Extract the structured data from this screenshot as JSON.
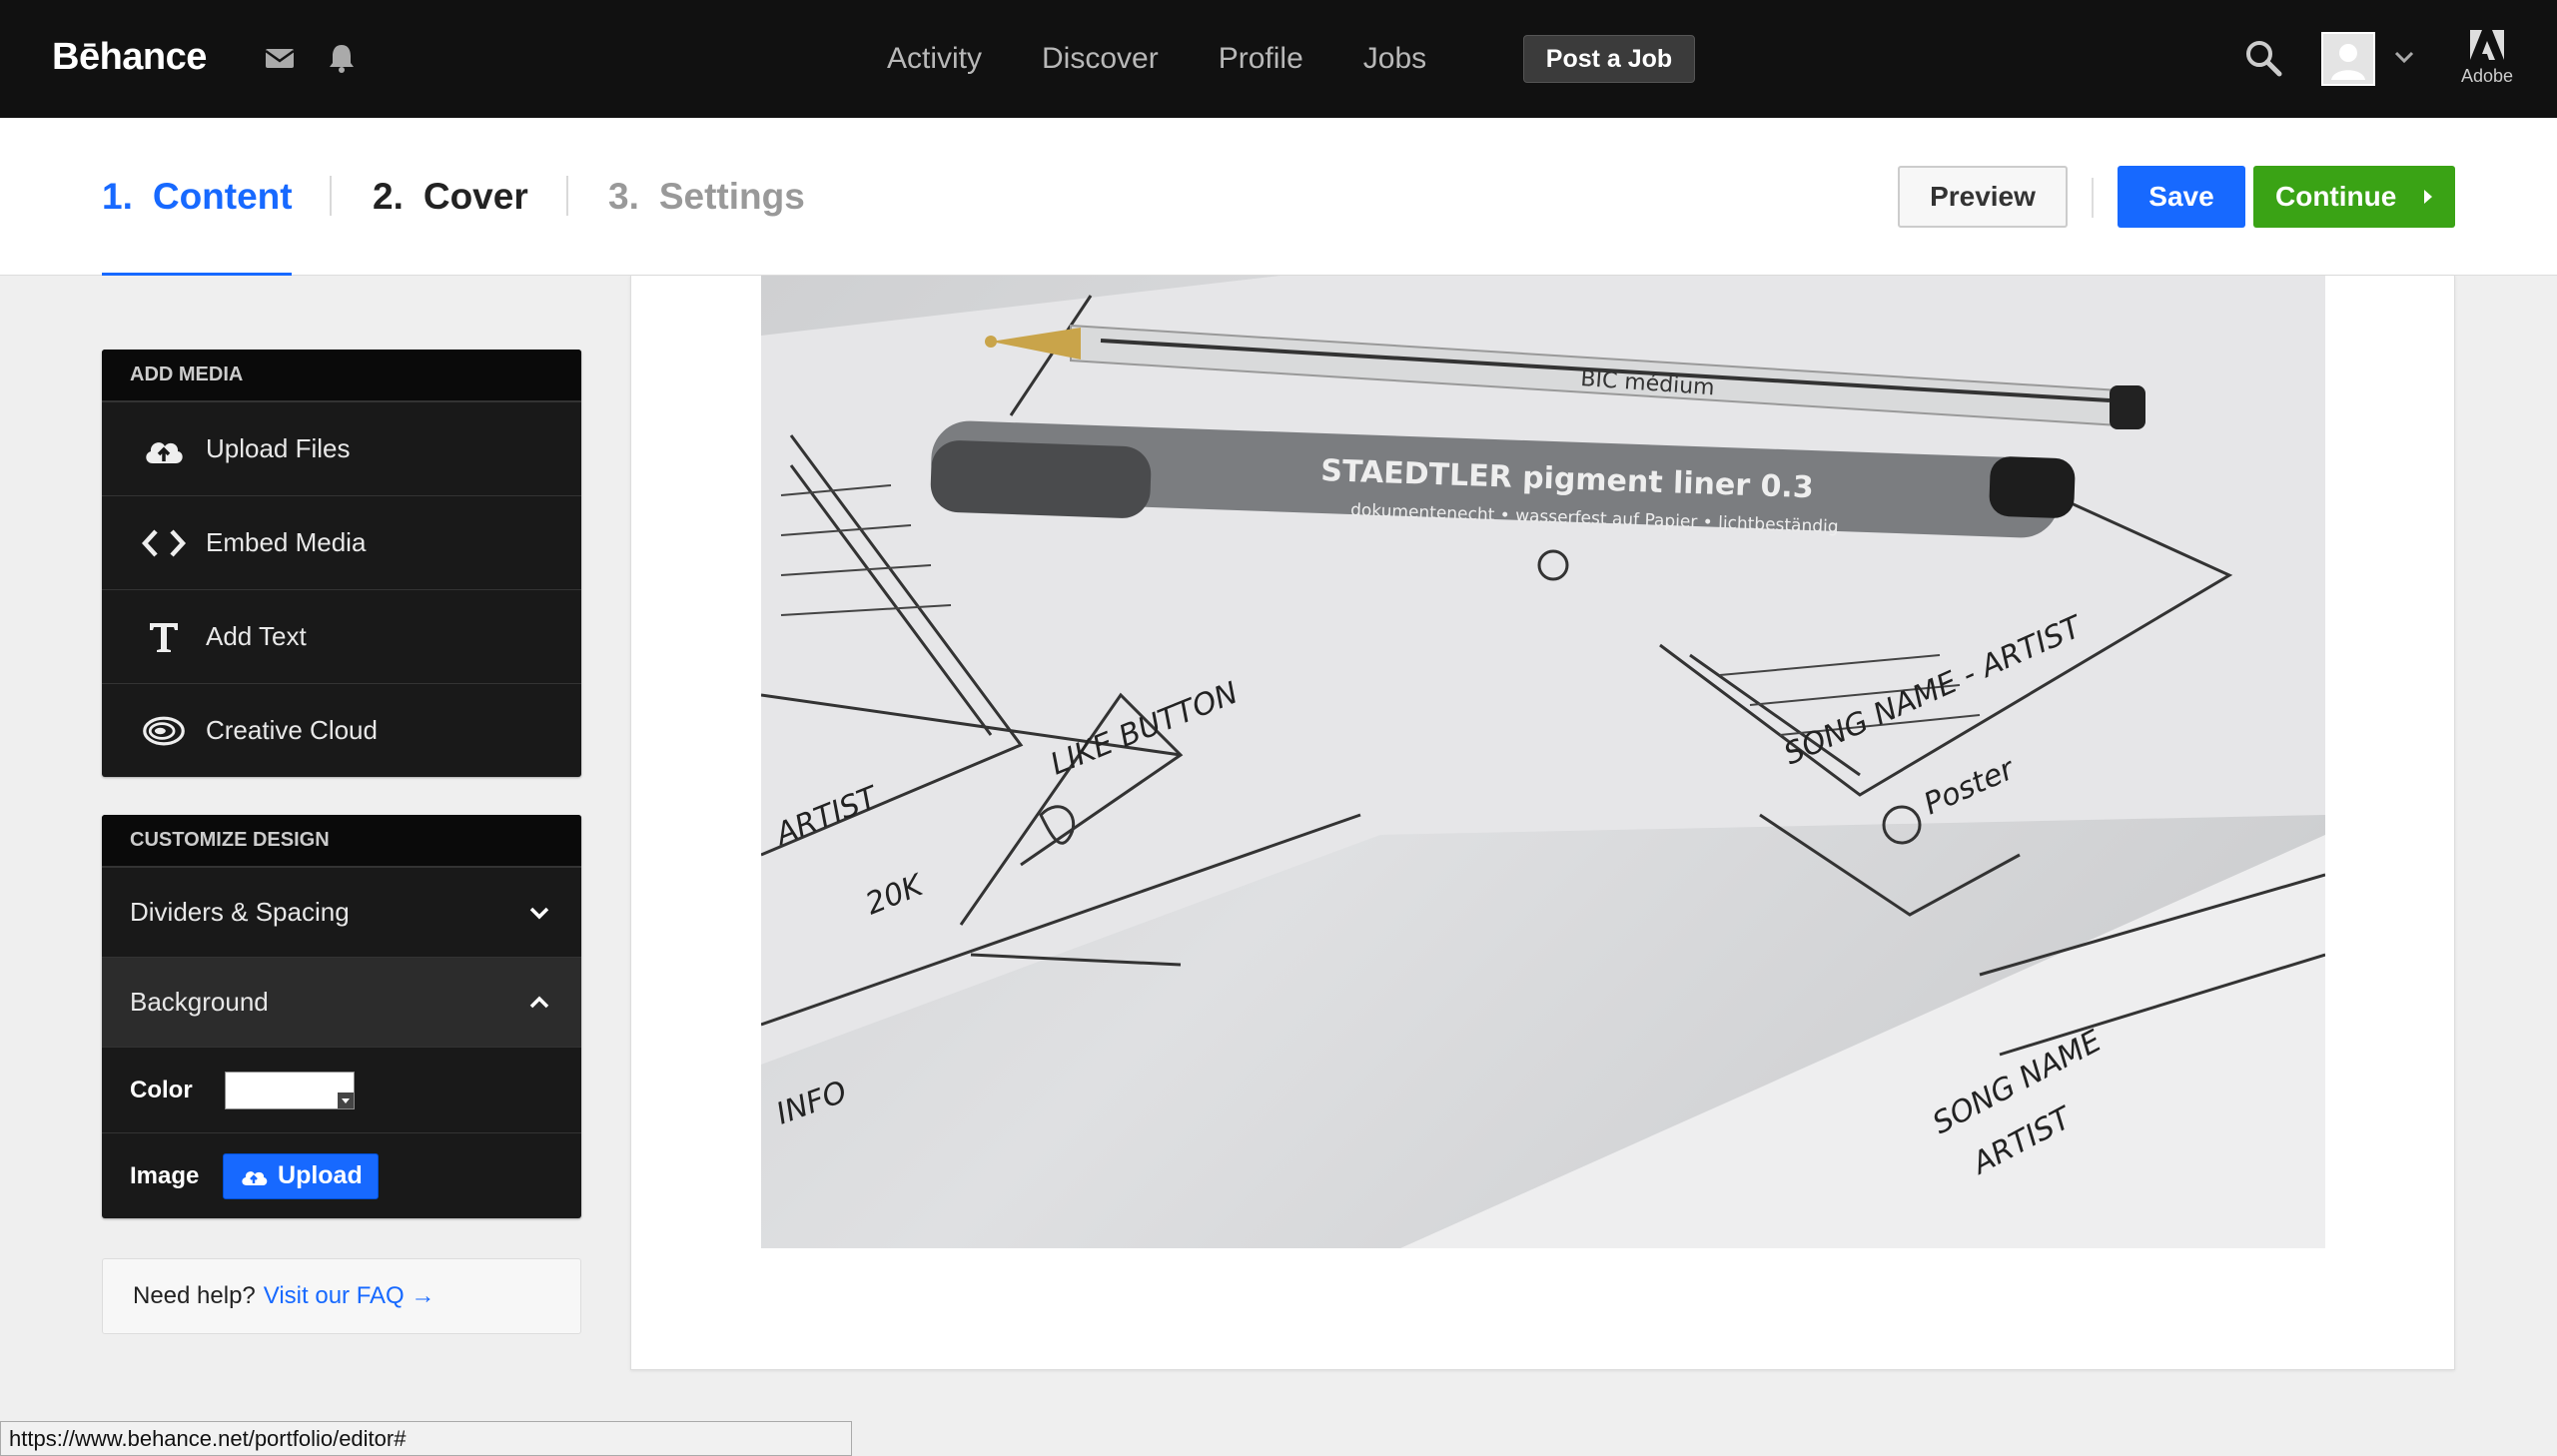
{
  "topnav": {
    "logo": "Bēhance",
    "links": [
      "Activity",
      "Discover",
      "Profile",
      "Jobs"
    ],
    "post_job": "Post a Job",
    "adobe": "Adobe"
  },
  "steps": [
    {
      "num": "1.",
      "label": "Content"
    },
    {
      "num": "2.",
      "label": "Cover"
    },
    {
      "num": "3.",
      "label": "Settings"
    }
  ],
  "actions": {
    "preview": "Preview",
    "save": "Save",
    "continue": "Continue"
  },
  "add_media": {
    "title": "ADD MEDIA",
    "items": [
      "Upload Files",
      "Embed Media",
      "Add Text",
      "Creative Cloud"
    ]
  },
  "customize": {
    "title": "CUSTOMIZE DESIGN",
    "dividers": "Dividers & Spacing",
    "background": "Background",
    "color_label": "Color",
    "image_label": "Image",
    "upload": "Upload"
  },
  "help": {
    "text": "Need help?",
    "link": "Visit our FAQ →"
  },
  "photo_text": {
    "bic": "BIC médium",
    "staedtler": "STAEDTLER pigment liner 0.3",
    "staedtler_sub": "dokumentenecht • wasserfest auf Papier • lichtbeständig",
    "like_button": "LIKE BUTTON",
    "song_name_artist": "SONG NAME - ARTIST",
    "poster": "Poster",
    "artist": "ARTIST",
    "count": "20K",
    "info": "INFO",
    "song_name": "SONG NAME",
    "artist2": "ARTIST"
  },
  "statusbar": "https://www.behance.net/portfolio/editor#",
  "colors": {
    "brand_blue": "#1769ff",
    "continue_green": "#3aa315",
    "nav_bg": "#111111"
  }
}
